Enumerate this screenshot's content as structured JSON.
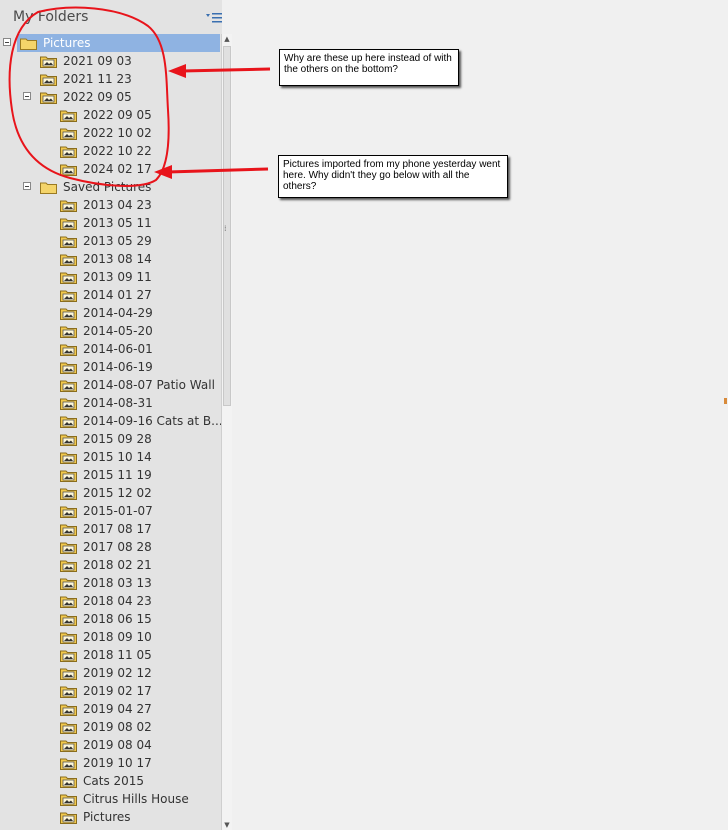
{
  "panel": {
    "title": "My Folders"
  },
  "tree": [
    {
      "label": "Pictures",
      "level": 0,
      "expandable": true,
      "selected": true,
      "icon": "plain-folder-icon"
    },
    {
      "label": "2021 09 03",
      "level": 1,
      "icon": "image-folder-icon"
    },
    {
      "label": "2021 11 23",
      "level": 1,
      "icon": "image-folder-icon"
    },
    {
      "label": "2022 09 05",
      "level": 1,
      "expandable": true,
      "icon": "image-folder-icon"
    },
    {
      "label": "2022 09 05",
      "level": 2,
      "icon": "image-folder-icon"
    },
    {
      "label": "2022 10 02",
      "level": 2,
      "icon": "image-folder-icon"
    },
    {
      "label": "2022 10 22",
      "level": 2,
      "icon": "image-folder-icon"
    },
    {
      "label": "2024 02 17",
      "level": 2,
      "icon": "image-folder-icon"
    },
    {
      "label": "Saved Pictures",
      "level": 1,
      "expandable": true,
      "icon": "plain-folder-icon"
    },
    {
      "label": "2013 04 23",
      "level": 2,
      "icon": "image-folder-icon"
    },
    {
      "label": "2013 05 11",
      "level": 2,
      "icon": "image-folder-icon"
    },
    {
      "label": "2013 05 29",
      "level": 2,
      "icon": "image-folder-icon"
    },
    {
      "label": "2013 08 14",
      "level": 2,
      "icon": "image-folder-icon"
    },
    {
      "label": "2013 09 11",
      "level": 2,
      "icon": "image-folder-icon"
    },
    {
      "label": "2014 01 27",
      "level": 2,
      "icon": "image-folder-icon"
    },
    {
      "label": "2014-04-29",
      "level": 2,
      "icon": "image-folder-icon"
    },
    {
      "label": "2014-05-20",
      "level": 2,
      "icon": "image-folder-icon"
    },
    {
      "label": "2014-06-01",
      "level": 2,
      "icon": "image-folder-icon"
    },
    {
      "label": "2014-06-19",
      "level": 2,
      "icon": "image-folder-icon"
    },
    {
      "label": "2014-08-07 Patio Wall",
      "level": 2,
      "icon": "image-folder-icon"
    },
    {
      "label": "2014-08-31",
      "level": 2,
      "icon": "image-folder-icon"
    },
    {
      "label": "2014-09-16 Cats at B...",
      "level": 2,
      "icon": "image-folder-icon"
    },
    {
      "label": "2015 09 28",
      "level": 2,
      "icon": "image-folder-icon"
    },
    {
      "label": "2015 10 14",
      "level": 2,
      "icon": "image-folder-icon"
    },
    {
      "label": "2015 11 19",
      "level": 2,
      "icon": "image-folder-icon"
    },
    {
      "label": "2015 12 02",
      "level": 2,
      "icon": "image-folder-icon"
    },
    {
      "label": "2015-01-07",
      "level": 2,
      "icon": "image-folder-icon"
    },
    {
      "label": "2017 08 17",
      "level": 2,
      "icon": "image-folder-icon"
    },
    {
      "label": "2017 08 28",
      "level": 2,
      "icon": "image-folder-icon"
    },
    {
      "label": "2018 02 21",
      "level": 2,
      "icon": "image-folder-icon"
    },
    {
      "label": "2018 03 13",
      "level": 2,
      "icon": "image-folder-icon"
    },
    {
      "label": "2018 04 23",
      "level": 2,
      "icon": "image-folder-icon"
    },
    {
      "label": "2018 06 15",
      "level": 2,
      "icon": "image-folder-icon"
    },
    {
      "label": "2018 09 10",
      "level": 2,
      "icon": "image-folder-icon"
    },
    {
      "label": "2018 11 05",
      "level": 2,
      "icon": "image-folder-icon"
    },
    {
      "label": "2019 02 12",
      "level": 2,
      "icon": "image-folder-icon"
    },
    {
      "label": "2019 02 17",
      "level": 2,
      "icon": "image-folder-icon"
    },
    {
      "label": "2019 04 27",
      "level": 2,
      "icon": "image-folder-icon"
    },
    {
      "label": "2019 08 02",
      "level": 2,
      "icon": "image-folder-icon"
    },
    {
      "label": "2019 08 04",
      "level": 2,
      "icon": "image-folder-icon"
    },
    {
      "label": "2019 10 17",
      "level": 2,
      "icon": "image-folder-icon"
    },
    {
      "label": "Cats 2015",
      "level": 2,
      "icon": "image-folder-icon"
    },
    {
      "label": "Citrus Hills House",
      "level": 2,
      "icon": "image-folder-icon"
    },
    {
      "label": "Pictures",
      "level": 2,
      "icon": "image-folder-icon"
    }
  ],
  "annotations": {
    "note1": "Why are these up here instead of with the others on the bottom?",
    "note2": "Pictures imported from my phone yesterday went here. Why didn't they go below with all the others?"
  },
  "colors": {
    "panel_bg": "#e3e3e3",
    "selection": "#8fb3e2",
    "annotation_red": "#e8141b",
    "folder_yellow": "#f2c94c"
  }
}
